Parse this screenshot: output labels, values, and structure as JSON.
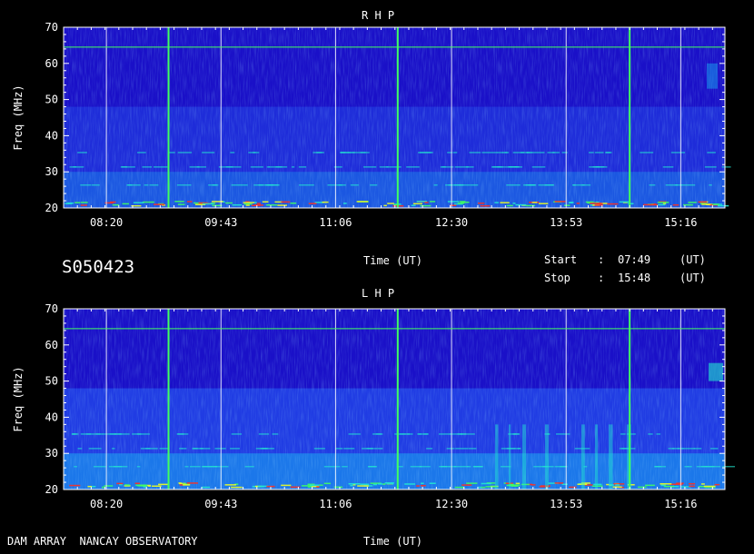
{
  "chart_data": [
    {
      "type": "heatmap",
      "title": "R H P",
      "ylabel": "Freq (MHz)",
      "xlabel": "Time (UT)",
      "ylim": [
        20,
        70
      ],
      "yticks": [
        "20",
        "30",
        "40",
        "50",
        "60",
        "70"
      ],
      "xlim": [
        "07:49",
        "15:48"
      ],
      "xticks": [
        "08:20",
        "09:43",
        "11:06",
        "12:30",
        "13:53",
        "15:16"
      ],
      "grid": true,
      "colormap": [
        "#1a10c8",
        "#2244e8",
        "#18a8f0",
        "#22e8d0",
        "#40ff60",
        "#f0ff20",
        "#ff3020"
      ],
      "marker_lines": {
        "vertical_time": [
          "09:05",
          "11:51",
          "14:39"
        ],
        "horizontal_freq": [
          64.5
        ],
        "color": "#40ff60"
      }
    },
    {
      "type": "heatmap",
      "title": "L H P",
      "ylabel": "Freq (MHz)",
      "xlabel": "Time (UT)",
      "ylim": [
        20,
        70
      ],
      "yticks": [
        "20",
        "30",
        "40",
        "50",
        "60",
        "70"
      ],
      "xlim": [
        "07:49",
        "15:48"
      ],
      "xticks": [
        "08:20",
        "09:43",
        "11:06",
        "12:30",
        "13:53",
        "15:16"
      ],
      "grid": true,
      "colormap": [
        "#1a10c8",
        "#2244e8",
        "#18a8f0",
        "#22e8d0",
        "#40ff60",
        "#f0ff20",
        "#ff3020"
      ],
      "marker_lines": {
        "vertical_time": [
          "09:05",
          "11:51",
          "14:39"
        ],
        "horizontal_freq": [
          64.5
        ],
        "color": "#40ff60"
      }
    }
  ],
  "observation_id": "S050423",
  "start_label": "Start",
  "start_sep": ":",
  "start_time": "07:49",
  "start_unit": "(UT)",
  "stop_label": "Stop",
  "stop_sep": ":",
  "stop_time": "15:48",
  "stop_unit": "(UT)",
  "footer": "DAM ARRAY  NANCAY OBSERVATORY"
}
